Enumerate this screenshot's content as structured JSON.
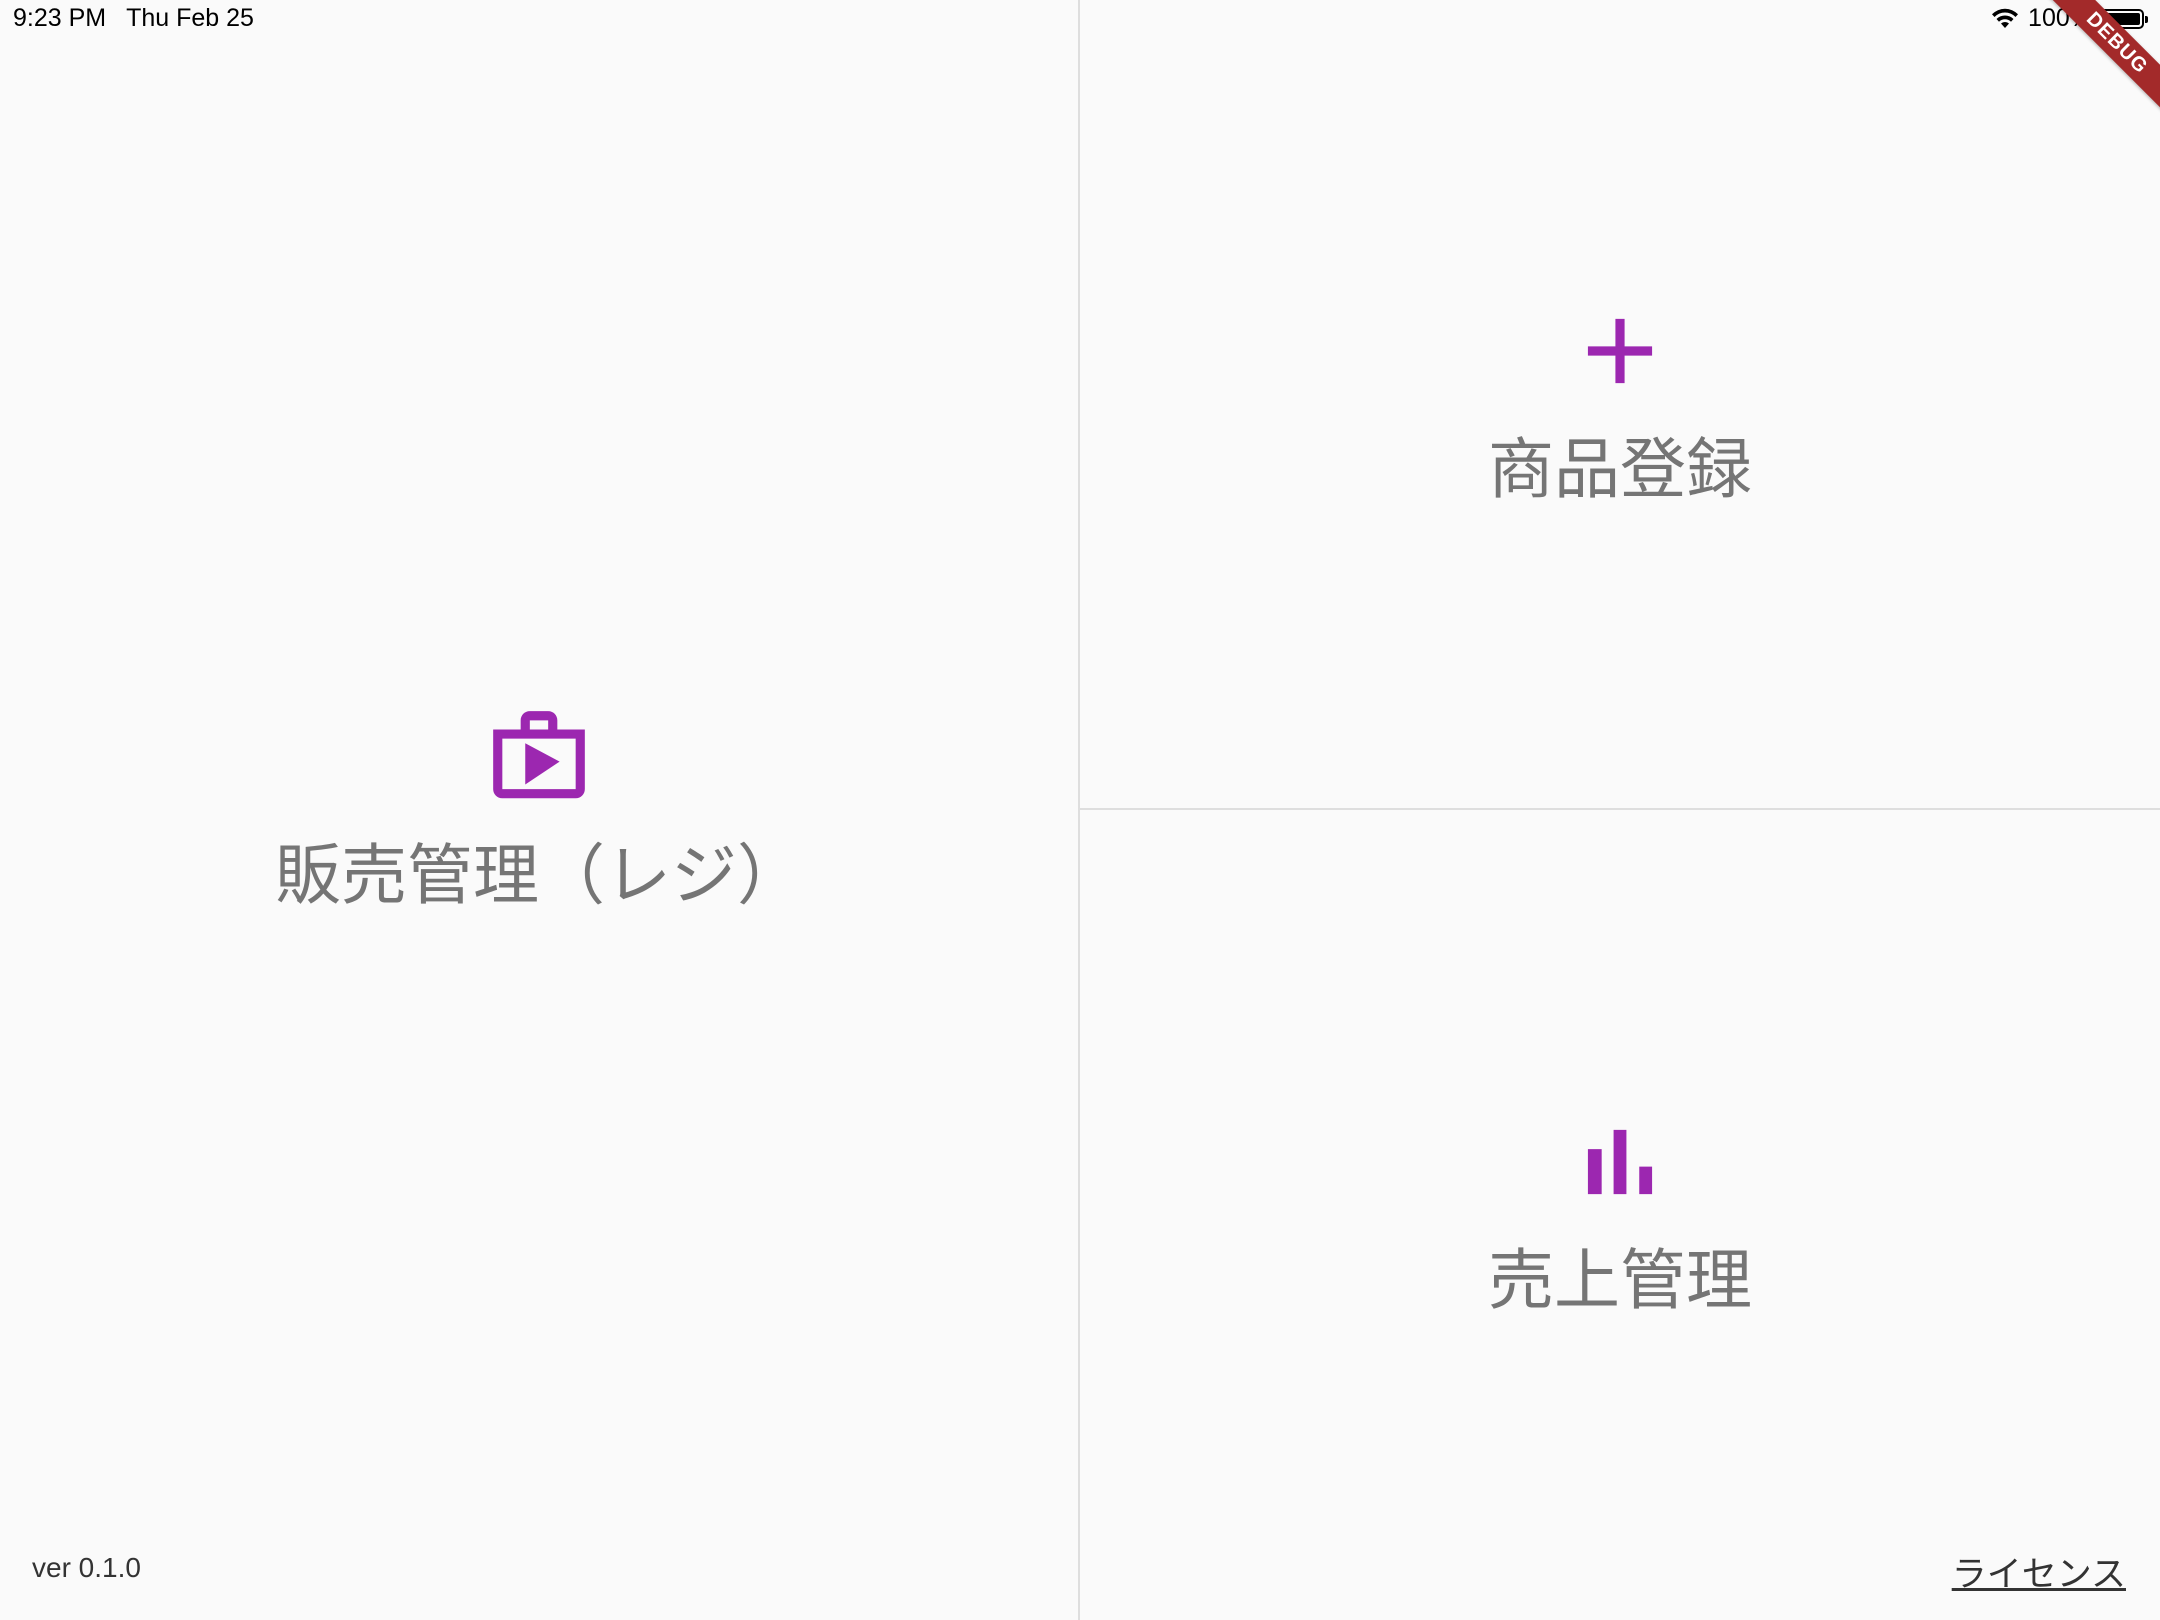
{
  "status_bar": {
    "time": "9:23 PM",
    "date": "Thu Feb 25",
    "battery": "100%",
    "icons": [
      "wifi-icon",
      "battery-icon"
    ]
  },
  "debug_banner": "DEBUG",
  "tiles": {
    "register": {
      "label": "販売管理（レジ）",
      "icon": "shop-bag-play-icon"
    },
    "product_registration": {
      "label": "商品登録",
      "icon": "plus-icon"
    },
    "sales_management": {
      "label": "売上管理",
      "icon": "bar-chart-icon"
    }
  },
  "footer": {
    "version": "ver 0.1.0",
    "license": "ライセンス"
  },
  "colors": {
    "accent": "#9c27b0",
    "label": "#757575",
    "background": "#fafafa",
    "divider": "#dedede",
    "debug_banner": "#a32a2a"
  }
}
